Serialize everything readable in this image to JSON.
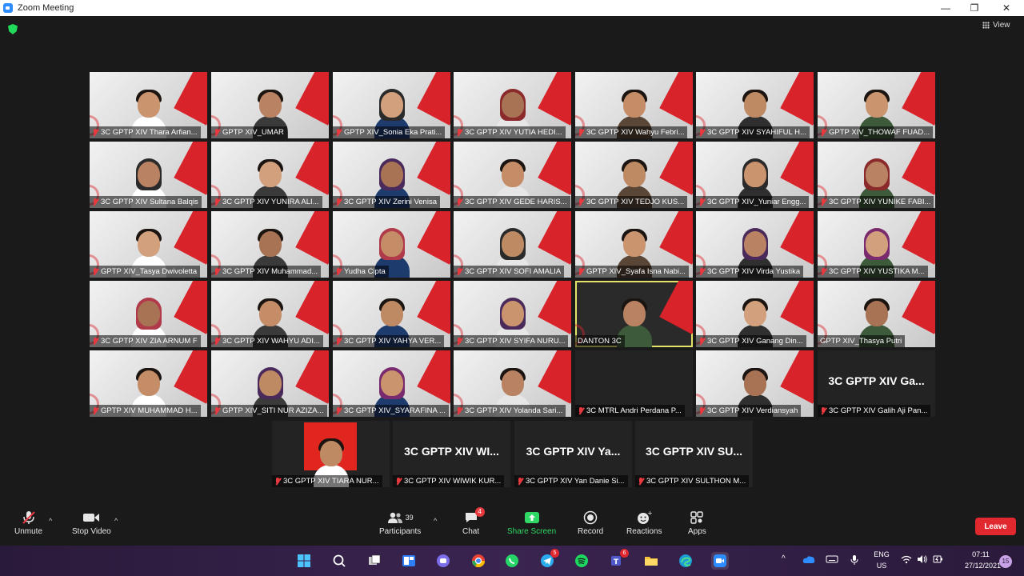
{
  "window": {
    "title": "Zoom Meeting",
    "minimize_glyph": "—",
    "maximize_glyph": "❐",
    "close_glyph": "✕"
  },
  "meeting": {
    "view_label": "View",
    "security_icon": "shield-icon",
    "participant_tiles": [
      {
        "name": "3C GPTP XIV Thara Arfian...",
        "kind": "video",
        "muted": true
      },
      {
        "name": "GPTP XIV_UMAR",
        "kind": "video",
        "muted": true
      },
      {
        "name": "GPTP XIV_Sonia Eka Prati...",
        "kind": "video",
        "muted": true
      },
      {
        "name": "3C GPTP XIV YUTIA HEDI...",
        "kind": "video",
        "muted": true
      },
      {
        "name": "3C GPTP XIV Wahyu Febri...",
        "kind": "video",
        "muted": true
      },
      {
        "name": "3C GPTP XIV SYAHIFUL H...",
        "kind": "video",
        "muted": true
      },
      {
        "name": "GPTP XIV_THOWAF FUAD...",
        "kind": "video",
        "muted": true
      },
      {
        "name": "3C GPTP XIV Sultana Balqis",
        "kind": "video",
        "muted": true
      },
      {
        "name": "3C GPTP XIV YUNIRA ALI...",
        "kind": "video",
        "muted": true
      },
      {
        "name": "3C GPTP XIV Zerini Venisa",
        "kind": "video",
        "muted": true
      },
      {
        "name": "3C GPTP XIV GEDE HARIS...",
        "kind": "video",
        "muted": true
      },
      {
        "name": "3C GPTP XIV TEDJO KUS...",
        "kind": "video",
        "muted": true
      },
      {
        "name": "3C GPTP XIV_Yuniar Engg...",
        "kind": "video",
        "muted": true
      },
      {
        "name": "3C GPTP XIV YUNIKE FABI...",
        "kind": "video",
        "muted": true
      },
      {
        "name": "GPTP XIV_Tasya Dwivoletta",
        "kind": "video",
        "muted": true
      },
      {
        "name": "3C GPTP XIV Muhammad...",
        "kind": "video",
        "muted": true
      },
      {
        "name": "Yudha Cipta",
        "kind": "video",
        "muted": true
      },
      {
        "name": "3C GPTP XIV SOFI AMALIA",
        "kind": "video",
        "muted": true
      },
      {
        "name": "GPTP XIV_Syafa Isna Nabi...",
        "kind": "video",
        "muted": true
      },
      {
        "name": "3C GPTP XIV Virda Yustika",
        "kind": "video",
        "muted": true
      },
      {
        "name": "3C GPTP XIV YUSTIKA M...",
        "kind": "video",
        "muted": true
      },
      {
        "name": "3C GPTP XIV ZIA ARNUM F",
        "kind": "video",
        "muted": true
      },
      {
        "name": "3C GPTP XIV WAHYU ADI...",
        "kind": "video",
        "muted": true
      },
      {
        "name": "3C GPTP XIV YAHYA VER...",
        "kind": "video",
        "muted": true
      },
      {
        "name": "3C GPTP XIV SYIFA NURU...",
        "kind": "video",
        "muted": true
      },
      {
        "name": "DANTON 3C",
        "kind": "video",
        "muted": false,
        "active_speaker": true
      },
      {
        "name": "3C GPTP XIV Ganang Din...",
        "kind": "video",
        "muted": true
      },
      {
        "name": "GPTP XIV_Thasya Putri",
        "kind": "video",
        "muted": false
      },
      {
        "name": "GPTP XIV MUHAMMAD H...",
        "kind": "video",
        "muted": true
      },
      {
        "name": "GPTP XIV_SITI NUR AZIZA...",
        "kind": "video",
        "muted": true
      },
      {
        "name": "3C GPTP XIV_SYARAFINA ...",
        "kind": "video",
        "muted": true
      },
      {
        "name": "3C GPTP XIV Yolanda Sari...",
        "kind": "video",
        "muted": true
      },
      {
        "name": "3C MTRL Andri Perdana P...",
        "kind": "dark",
        "muted": true
      },
      {
        "name": "3C GPTP XIV Verdiansyah",
        "kind": "video",
        "muted": true
      },
      {
        "name": "3C GPTP XIV Galih Aji Pan...",
        "kind": "name-only",
        "muted": true,
        "big_name": "3C GPTP XIV Ga..."
      },
      {
        "name": "3C GPTP XIV TIARA NUR...",
        "kind": "red-photo",
        "muted": true
      },
      {
        "name": "3C GPTP XIV WIWIK KUR...",
        "kind": "name-only",
        "muted": true,
        "big_name": "3C GPTP XIV WI..."
      },
      {
        "name": "3C GPTP XIV Yan Danie Si...",
        "kind": "name-only",
        "muted": true,
        "big_name": "3C GPTP XIV Ya..."
      },
      {
        "name": "3C GPTP XIV SULTHON M...",
        "kind": "name-only",
        "muted": true,
        "big_name": "3C GPTP XIV SU..."
      }
    ]
  },
  "toolbar": {
    "unmute_label": "Unmute",
    "stop_video_label": "Stop Video",
    "participants_label": "Participants",
    "participants_count": "39",
    "chat_label": "Chat",
    "chat_badge": "4",
    "share_screen_label": "Share Screen",
    "record_label": "Record",
    "reactions_label": "Reactions",
    "apps_label": "Apps",
    "leave_label": "Leave",
    "accent_share": "#2fd864",
    "accent_leave": "#e0282e"
  },
  "taskbar": {
    "telegram_badge": "5",
    "teams_badge": "6",
    "lang_line1": "ENG",
    "lang_line2": "US",
    "time": "07:11",
    "date": "27/12/2021",
    "notification_count": "15"
  }
}
